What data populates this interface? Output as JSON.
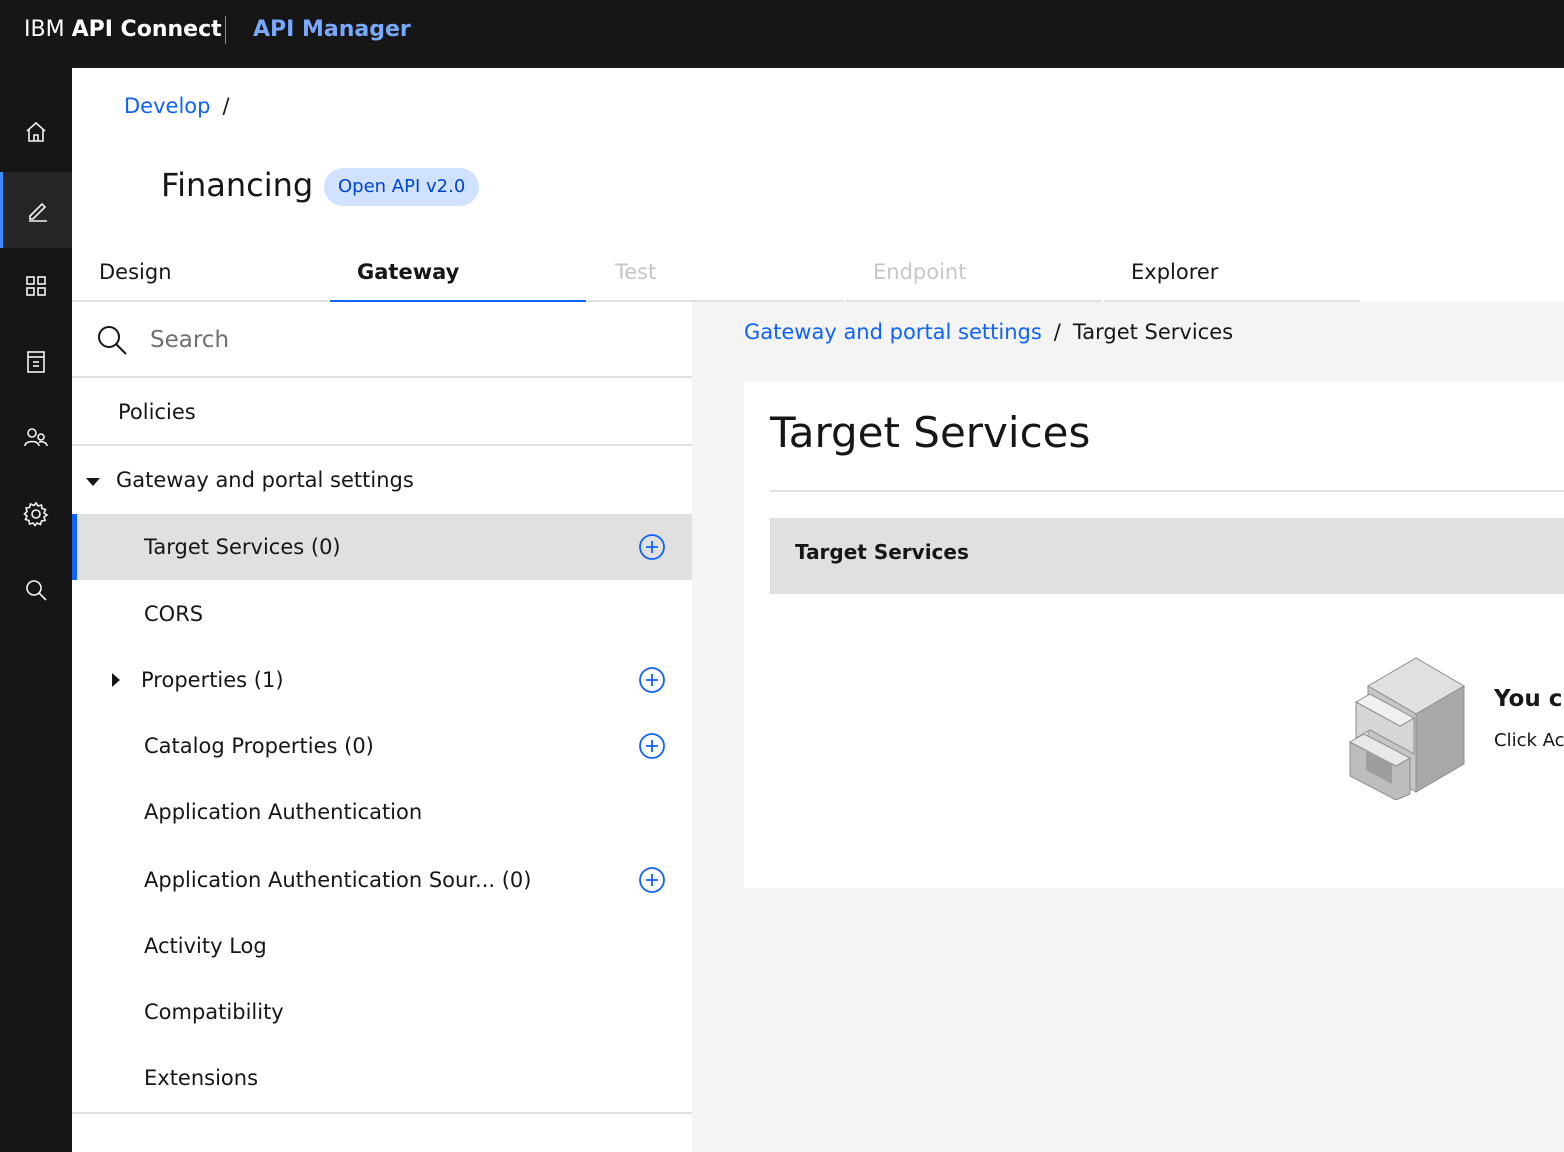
{
  "header": {
    "brand_prefix": "IBM",
    "brand_product": "API Connect",
    "app_name": "API Manager"
  },
  "rail": {
    "items": [
      {
        "icon": "home-icon"
      },
      {
        "icon": "edit-icon",
        "active": true
      },
      {
        "icon": "apps-grid-icon"
      },
      {
        "icon": "catalog-icon"
      },
      {
        "icon": "users-icon"
      },
      {
        "icon": "gear-icon"
      },
      {
        "icon": "search-icon"
      }
    ]
  },
  "breadcrumb": {
    "develop": "Develop",
    "sep": "/"
  },
  "api": {
    "title": "Financing",
    "badge": "Open API v2.0"
  },
  "tabs": [
    {
      "label": "Design",
      "state": "normal"
    },
    {
      "label": "Gateway",
      "state": "active"
    },
    {
      "label": "Test",
      "state": "disabled"
    },
    {
      "label": "Endpoint",
      "state": "disabled"
    },
    {
      "label": "Explorer",
      "state": "normal"
    }
  ],
  "nav": {
    "search_placeholder": "Search",
    "policies": "Policies",
    "gateway_settings": "Gateway and portal settings",
    "items": [
      {
        "label": "Target Services (0)",
        "add": true,
        "selected": true
      },
      {
        "label": "CORS",
        "add": false
      },
      {
        "label": "Properties (1)",
        "add": true,
        "expandable": true
      },
      {
        "label": "Catalog Properties (0)",
        "add": true
      },
      {
        "label": "Application Authentication",
        "add": false
      },
      {
        "label": "Application Authentication Sour... (0)",
        "add": true
      },
      {
        "label": "Activity Log",
        "add": false
      },
      {
        "label": "Compatibility",
        "add": false
      },
      {
        "label": "Extensions",
        "add": false
      }
    ]
  },
  "content": {
    "breadcrumb_link": "Gateway and portal settings",
    "breadcrumb_sep": "/",
    "breadcrumb_current": "Target Services",
    "card_title": "Target Services",
    "table_header": "Target Services",
    "empty_title": "You cu",
    "empty_text": "Click Ac"
  },
  "colors": {
    "accent": "#0f62fe",
    "header_bg": "#161616",
    "app_name": "#78a9ff",
    "badge_bg": "#d0e2ff",
    "selected_bg": "#e0e0e0",
    "content_bg": "#f4f4f4"
  }
}
